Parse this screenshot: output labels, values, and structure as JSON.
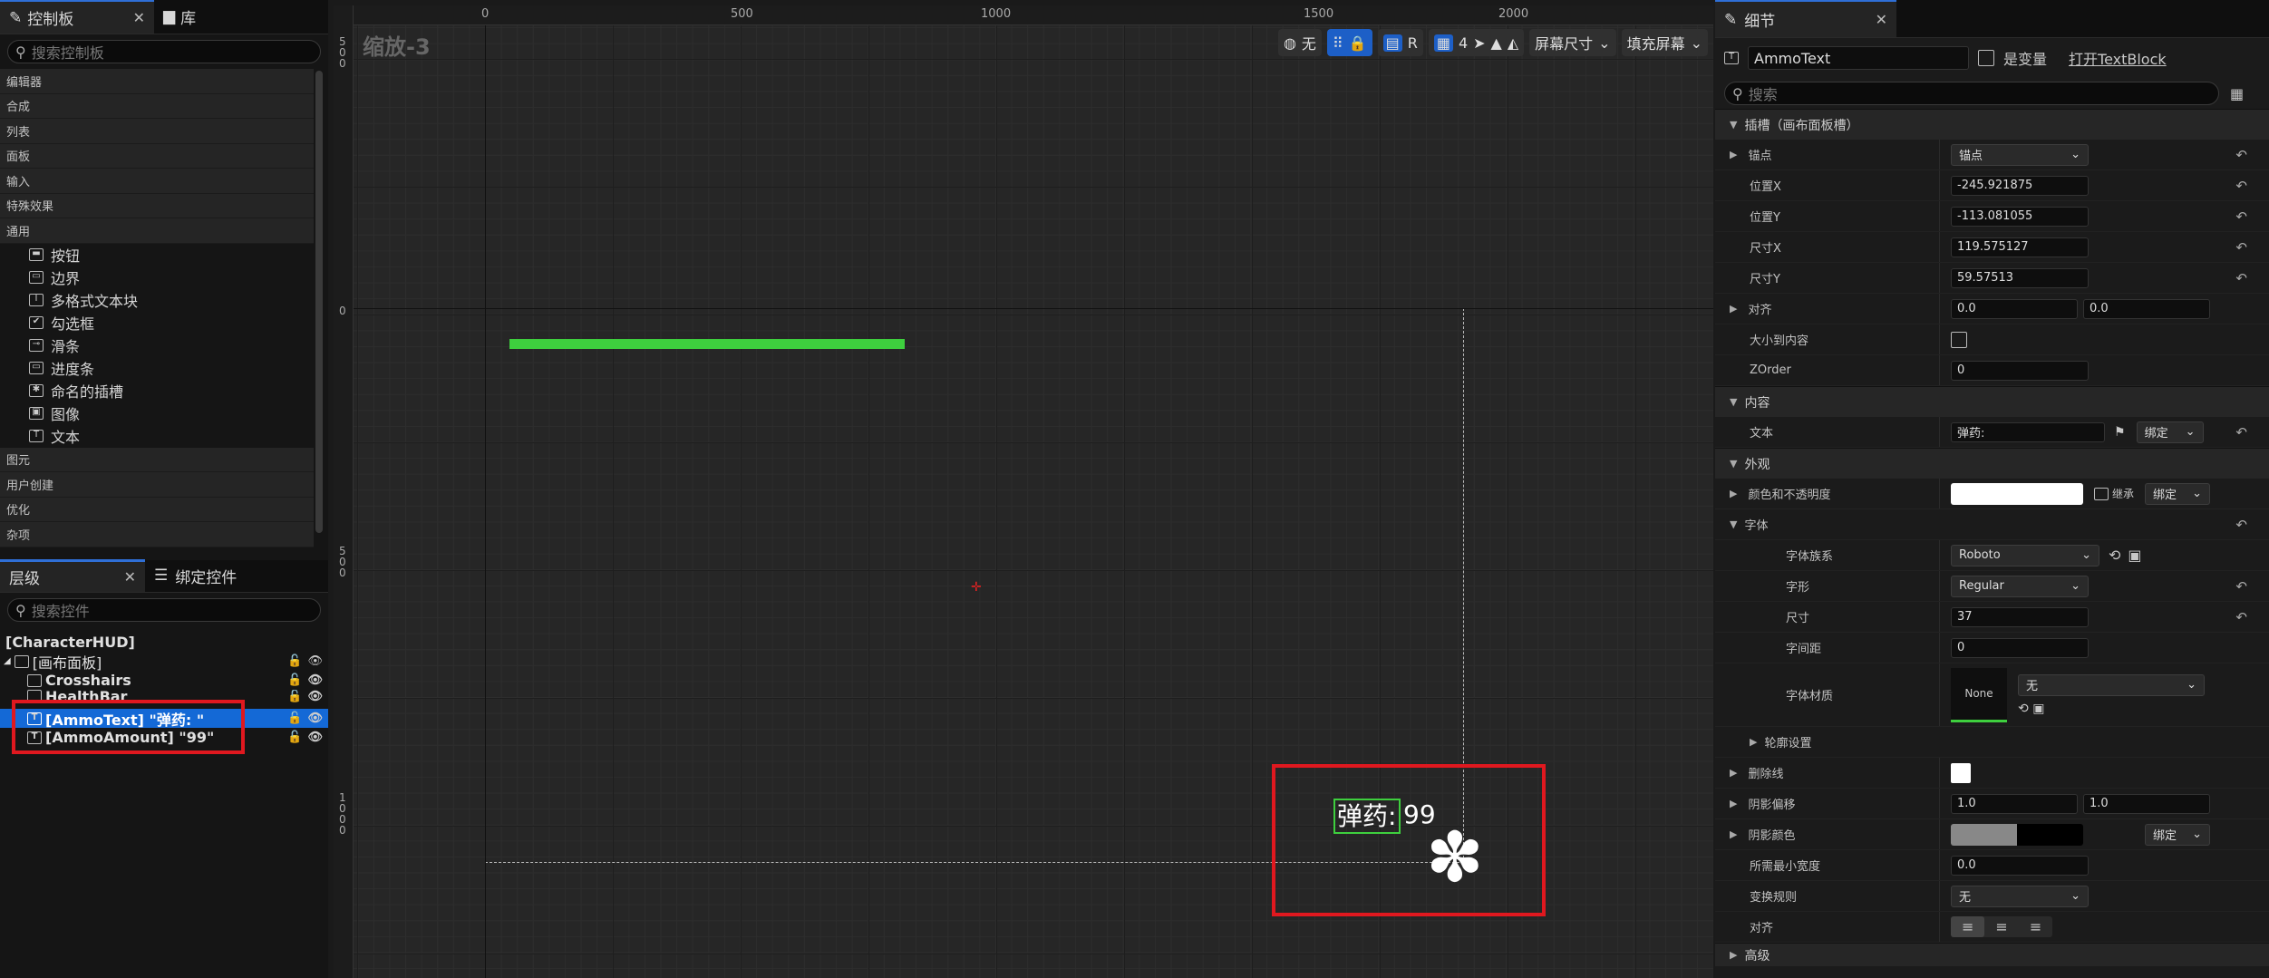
{
  "palette": {
    "tab_label": "控制板",
    "library_label": "库",
    "search_placeholder": "搜索控制板",
    "categories_top": [
      "编辑器",
      "合成",
      "列表",
      "面板",
      "输入",
      "特殊效果",
      "通用"
    ],
    "common_items": [
      {
        "icon": "button-icon",
        "label": "按钮"
      },
      {
        "icon": "border-icon",
        "label": "边界"
      },
      {
        "icon": "rich-text-icon",
        "label": "多格式文本块"
      },
      {
        "icon": "checkbox-icon",
        "label": "勾选框"
      },
      {
        "icon": "slider-icon",
        "label": "滑条"
      },
      {
        "icon": "progress-icon",
        "label": "进度条"
      },
      {
        "icon": "named-slot-icon",
        "label": "命名的插槽"
      },
      {
        "icon": "image-icon",
        "label": "图像"
      },
      {
        "icon": "text-icon",
        "label": "文本"
      }
    ],
    "categories_bottom": [
      "图元",
      "用户创建",
      "优化",
      "杂项"
    ]
  },
  "hierarchy": {
    "tab_label": "层级",
    "bind_tab_label": "绑定控件",
    "search_placeholder": "搜索控件",
    "root": "[CharacterHUD]",
    "canvas_panel": "[画布面板]",
    "children": [
      "Crosshairs",
      "HealthBar",
      "[AmmoText] \"弹药: \"",
      "[AmmoAmount] \"99\""
    ]
  },
  "viewport": {
    "zoom_label": "缩放-3",
    "ruler_top": [
      "0",
      "500",
      "1000",
      "1500",
      "2000"
    ],
    "ruler_left": [
      "5\n0\n0",
      "0",
      "5\n0\n0",
      "1\n0\n0\n0"
    ],
    "toolbar": {
      "world_label": "无",
      "r_label": "R",
      "grid_value": "4",
      "screen_size_label": "屏幕尺寸",
      "fill_screen_label": "填充屏幕"
    },
    "preview_text": "弹药: ",
    "preview_amount": "99",
    "colors": {
      "healthbar": "#3ecf3e",
      "highlight": "#e0181f"
    }
  },
  "details": {
    "tab_label": "细节",
    "widget_name": "AmmoText",
    "is_variable_label": "是变量",
    "open_link": "打开TextBlock",
    "search_placeholder": "搜索",
    "slot_section": "插槽（画布面板槽）",
    "anchor_label": "锚点",
    "anchor_value": "锚点",
    "pos_x_label": "位置X",
    "pos_x": "-245.921875",
    "pos_y_label": "位置Y",
    "pos_y": "-113.081055",
    "size_x_label": "尺寸X",
    "size_x": "119.575127",
    "size_y_label": "尺寸Y",
    "size_y": "59.57513",
    "align_label": "对齐",
    "align_x": "0.0",
    "align_y": "0.0",
    "size_to_content_label": "大小到内容",
    "zorder_label": "ZOrder",
    "zorder": "0",
    "content_section": "内容",
    "text_label": "文本",
    "text_value": "弹药:",
    "bind_label": "绑定",
    "appearance_section": "外观",
    "color_label": "颜色和不透明度",
    "inherit_label": "继承",
    "font_label": "字体",
    "font_family_label": "字体族系",
    "font_family": "Roboto",
    "typeface_label": "字形",
    "typeface": "Regular",
    "font_size_label": "尺寸",
    "font_size": "37",
    "spacing_label": "字间距",
    "spacing": "0",
    "material_label": "字体材质",
    "material_thumb": "None",
    "material_value": "无",
    "outline_label": "轮廓设置",
    "strike_label": "删除线",
    "shadow_offset_label": "阴影偏移",
    "shadow_x": "1.0",
    "shadow_y": "1.0",
    "shadow_color_label": "阴影颜色",
    "min_width_label": "所需最小宽度",
    "min_width": "0.0",
    "transform_label": "变换规则",
    "transform_value": "无",
    "justify_label": "对齐",
    "advanced_section": "高级"
  }
}
